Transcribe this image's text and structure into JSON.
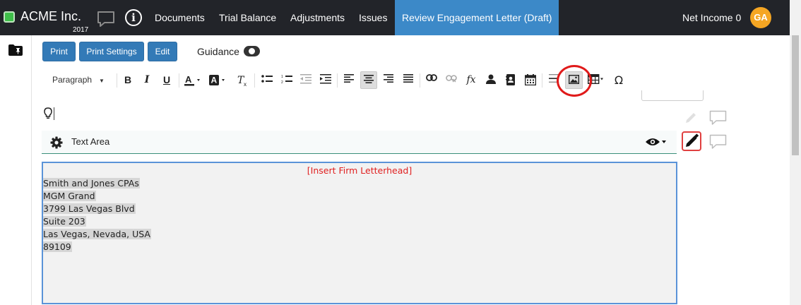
{
  "brand": {
    "name": "ACME Inc.",
    "year": "2017",
    "status_color": "#3fbf4a"
  },
  "nav": {
    "items": [
      "Documents",
      "Trial Balance",
      "Adjustments",
      "Issues",
      "Review Engagement Letter (Draft)"
    ],
    "active_index": 4,
    "net_income_label": "Net Income 0",
    "user_initials": "GA"
  },
  "actions": {
    "print": "Print",
    "print_settings": "Print Settings",
    "edit": "Edit",
    "guidance": "Guidance",
    "guidance_enabled": true
  },
  "toolbar": {
    "format_select": "Paragraph",
    "buttons": [
      "bold",
      "italic",
      "underline",
      "text-color",
      "background-color",
      "clear-formatting",
      "bulleted-list",
      "numbered-list",
      "outdent",
      "indent",
      "align-left",
      "align-center",
      "align-right",
      "justify",
      "link",
      "unlink",
      "formula",
      "user-field",
      "contact-card",
      "calendar",
      "horizontal-rule",
      "insert-image",
      "table",
      "special-character"
    ],
    "pressed": "align-center",
    "highlighted": "insert-image"
  },
  "section": {
    "title": "Text Area"
  },
  "letter": {
    "letterhead_placeholder": "[Insert Firm Letterhead]",
    "address_lines": [
      "Smith and Jones CPAs",
      "MGM Grand",
      "3799 Las Vegas Blvd",
      "Suite 203",
      "Las Vegas, Nevada, USA",
      "89109"
    ]
  },
  "colors": {
    "nav_bg": "#222429",
    "active_tab": "#3c89c8",
    "primary_button": "#337ab7",
    "avatar": "#f5a623",
    "highlight_ring": "#e01a1a",
    "placeholder_text": "#e02020"
  }
}
